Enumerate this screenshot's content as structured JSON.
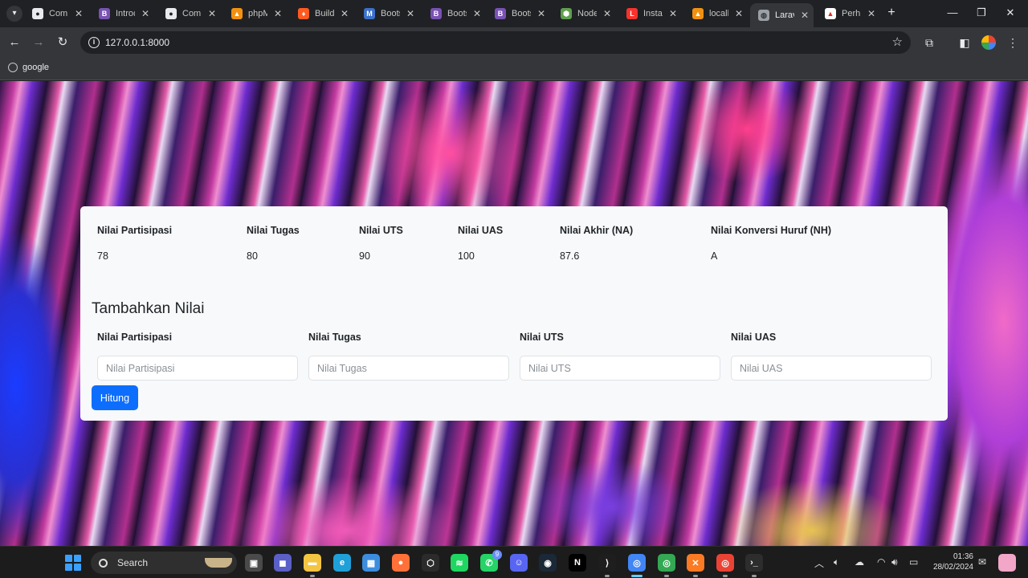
{
  "browser": {
    "tabs": [
      {
        "title": "Comp",
        "favicon": "github-icon",
        "color": "#e8eaed",
        "fg": "#202124",
        "glyph": "●"
      },
      {
        "title": "Introd",
        "favicon": "bootstrap-icon",
        "color": "#7952b3",
        "fg": "#ffffff",
        "glyph": "B"
      },
      {
        "title": "Comp",
        "favicon": "github-icon",
        "color": "#e8eaed",
        "fg": "#202124",
        "glyph": "●"
      },
      {
        "title": "phpM",
        "favicon": "phpmyadmin-icon",
        "color": "#f29111",
        "fg": "#ffffff",
        "glyph": "▲"
      },
      {
        "title": "Build",
        "favicon": "flame-icon",
        "color": "#ff5a1f",
        "fg": "#ffffff",
        "glyph": "♦"
      },
      {
        "title": "Boots",
        "favicon": "mdb-icon",
        "color": "#3b71ca",
        "fg": "#ffffff",
        "glyph": "M"
      },
      {
        "title": "Boots",
        "favicon": "bootstrap-icon",
        "color": "#7952b3",
        "fg": "#ffffff",
        "glyph": "B"
      },
      {
        "title": "Boots",
        "favicon": "bootstrap-icon",
        "color": "#7952b3",
        "fg": "#ffffff",
        "glyph": "B"
      },
      {
        "title": "Node",
        "favicon": "nodejs-icon",
        "color": "#5fa04e",
        "fg": "#ffffff",
        "glyph": "⬢"
      },
      {
        "title": "Instal",
        "favicon": "laravel-icon",
        "color": "#f9322c",
        "fg": "#ffffff",
        "glyph": "L"
      },
      {
        "title": "localh",
        "favicon": "php-icon",
        "color": "#f29111",
        "fg": "#ffffff",
        "glyph": "▲"
      },
      {
        "title": "Larav",
        "favicon": "globe-icon",
        "color": "#9aa0a6",
        "fg": "#35363a",
        "glyph": "◍",
        "active": true
      },
      {
        "title": "Perhi",
        "favicon": "pdf-icon",
        "color": "#ffffff",
        "fg": "#d93025",
        "glyph": "▲"
      }
    ],
    "url": "127.0.0.1:8000",
    "bookmark": "google"
  },
  "grades": {
    "headers": [
      "Nilai Partisipasi",
      "Nilai Tugas",
      "Nilai UTS",
      "Nilai UAS",
      "Nilai Akhir (NA)",
      "Nilai Konversi Huruf (NH)"
    ],
    "values": [
      "78",
      "80",
      "90",
      "100",
      "87.6",
      "A"
    ]
  },
  "form": {
    "title": "Tambahkan Nilai",
    "fields": [
      {
        "label": "Nilai Partisipasi",
        "placeholder": "Nilai Partisipasi",
        "value": ""
      },
      {
        "label": "Nilai Tugas",
        "placeholder": "Nilai Tugas",
        "value": ""
      },
      {
        "label": "Nilai UTS",
        "placeholder": "Nilai UTS",
        "value": ""
      },
      {
        "label": "Nilai UAS",
        "placeholder": "Nilai UAS",
        "value": ""
      }
    ],
    "submit_label": "Hitung"
  },
  "taskbar": {
    "search_label": "Search",
    "apps": [
      {
        "name": "task-view-icon",
        "color": "#4a4a4a",
        "glyph": "▣"
      },
      {
        "name": "chat-icon",
        "color": "#5b5fc7",
        "glyph": "◼"
      },
      {
        "name": "file-explorer-icon",
        "color": "#f4c542",
        "glyph": "▬"
      },
      {
        "name": "edge-icon",
        "color": "#1fa0d8",
        "glyph": "e"
      },
      {
        "name": "store-icon",
        "color": "#3c8dde",
        "glyph": "▦"
      },
      {
        "name": "firefox-icon",
        "color": "#ff7139",
        "glyph": "●"
      },
      {
        "name": "dev-app-icon",
        "color": "#2b2b2b",
        "glyph": "⬡"
      },
      {
        "name": "spotify-icon",
        "color": "#1ed760",
        "glyph": "≋"
      },
      {
        "name": "whatsapp-icon",
        "color": "#25d366",
        "glyph": "✆",
        "badge": "9"
      },
      {
        "name": "discord-icon",
        "color": "#5865f2",
        "glyph": "☺"
      },
      {
        "name": "steam-icon",
        "color": "#1b2838",
        "glyph": "◉"
      },
      {
        "name": "netflix-icon",
        "color": "#000000",
        "glyph": "N"
      },
      {
        "name": "vscode-icon",
        "color": "#1e1e1e",
        "glyph": "⟩"
      },
      {
        "name": "chrome-icon",
        "color": "#4285f4",
        "glyph": "◎",
        "active": true
      },
      {
        "name": "chrome-profile-icon",
        "color": "#34a853",
        "glyph": "◎"
      },
      {
        "name": "xampp-icon",
        "color": "#fb7a24",
        "glyph": "✕"
      },
      {
        "name": "chrome-icon",
        "color": "#ea4335",
        "glyph": "◎"
      },
      {
        "name": "terminal-icon",
        "color": "#2d2d2d",
        "glyph": "›_"
      }
    ],
    "time": "01:36",
    "date": "28/02/2024"
  }
}
